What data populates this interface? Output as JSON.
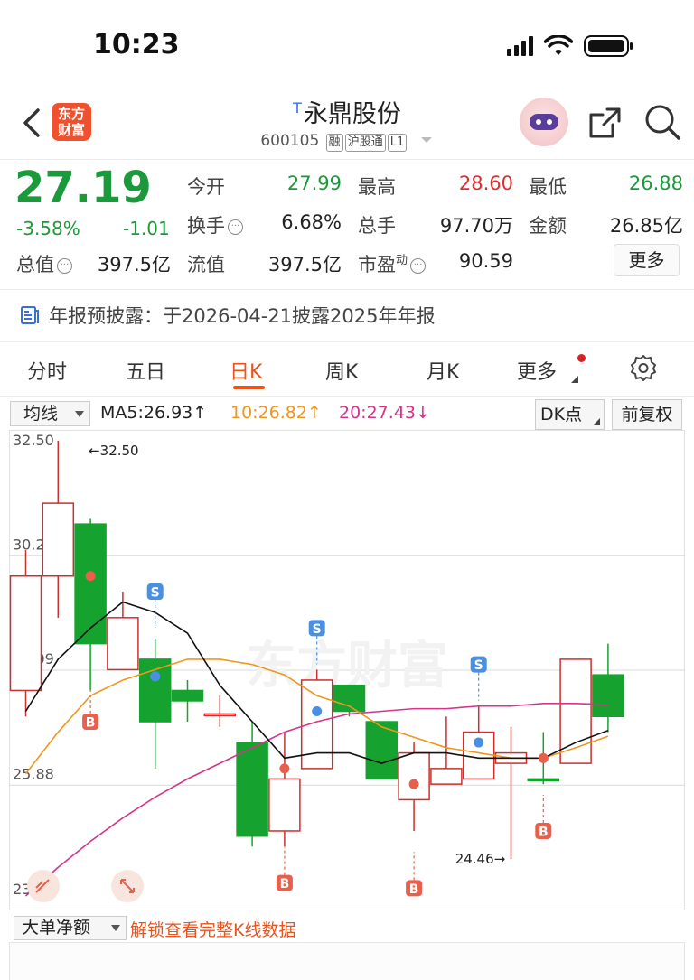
{
  "status_bar": {
    "time": "10:23"
  },
  "header": {
    "logo_text": "东方财富",
    "t_mark": "T",
    "stock_name": "永鼎股份",
    "code": "600105",
    "tags": [
      "融",
      "沪股通",
      "L1"
    ]
  },
  "quote": {
    "price": "27.19",
    "change_pct": "-3.58%",
    "change": "-1.01",
    "rows": [
      [
        {
          "label": "今开",
          "value": "27.99",
          "color": "green"
        },
        {
          "label": "最高",
          "value": "28.60",
          "color": "red"
        },
        {
          "label": "最低",
          "value": "26.88",
          "color": "green"
        }
      ],
      [
        {
          "label": "换手",
          "value": "6.68%",
          "info": true
        },
        {
          "label": "总手",
          "value": "97.70万"
        },
        {
          "label": "金额",
          "value": "26.85亿"
        }
      ]
    ],
    "row3": [
      {
        "label": "总值",
        "value": "397.5亿",
        "info": true
      },
      {
        "label": "流值",
        "value": "397.5亿"
      },
      {
        "label": "市盈",
        "sup": "动",
        "value": "90.59",
        "info": true
      }
    ],
    "more_label": "更多"
  },
  "notice": {
    "text": "年报预披露：于2026-04-21披露2025年年报"
  },
  "tabs": [
    "分时",
    "五日",
    "日K",
    "周K",
    "月K",
    "更多"
  ],
  "active_tab": 2,
  "ma_row": {
    "select": "均线",
    "ma5": "MA5:26.93↑",
    "ma10": "10:26.82↑",
    "ma20": "20:27.43↓",
    "dk_button": "DK点",
    "fq_button": "前复权"
  },
  "chart_data": {
    "type": "candlestick",
    "y_ticks": [
      "32.50",
      "30.29",
      "28.09",
      "25.88",
      "23.68"
    ],
    "ylim": [
      23.68,
      32.5
    ],
    "candles": [
      {
        "o": 27.7,
        "c": 29.9,
        "h": 30.4,
        "l": 27.2,
        "color": "red"
      },
      {
        "o": 29.9,
        "c": 31.3,
        "h": 32.5,
        "l": 29.1,
        "color": "red"
      },
      {
        "o": 30.9,
        "c": 28.6,
        "h": 31.0,
        "l": 27.7,
        "color": "green"
      },
      {
        "o": 28.1,
        "c": 29.1,
        "h": 29.6,
        "l": 28.1,
        "color": "red"
      },
      {
        "o": 28.3,
        "c": 27.1,
        "h": 28.7,
        "l": 26.2,
        "color": "green"
      },
      {
        "o": 27.7,
        "c": 27.5,
        "h": 27.9,
        "l": 27.1,
        "color": "green"
      },
      {
        "o": 27.25,
        "c": 27.25,
        "h": 27.6,
        "l": 27.0,
        "color": "red"
      },
      {
        "o": 26.7,
        "c": 24.9,
        "h": 27.1,
        "l": 24.7,
        "color": "green"
      },
      {
        "o": 25.0,
        "c": 26.0,
        "h": 26.9,
        "l": 24.7,
        "color": "red"
      },
      {
        "o": 26.2,
        "c": 27.9,
        "h": 28.1,
        "l": 26.2,
        "color": "red"
      },
      {
        "o": 27.8,
        "c": 27.3,
        "h": 27.8,
        "l": 27.2,
        "color": "green"
      },
      {
        "o": 27.1,
        "c": 26.0,
        "h": 27.1,
        "l": 26.0,
        "color": "green"
      },
      {
        "o": 25.6,
        "c": 26.5,
        "h": 26.7,
        "l": 25.0,
        "color": "red"
      },
      {
        "o": 25.9,
        "c": 26.2,
        "h": 27.2,
        "l": 25.9,
        "color": "red"
      },
      {
        "o": 26.0,
        "c": 26.9,
        "h": 27.4,
        "l": 26.0,
        "color": "red"
      },
      {
        "o": 26.3,
        "c": 26.5,
        "h": 27.0,
        "l": 24.46,
        "color": "red"
      },
      {
        "o": 26.0,
        "c": 26.0,
        "h": 26.9,
        "l": 25.9,
        "color": "green"
      },
      {
        "o": 26.3,
        "c": 28.3,
        "h": 28.3,
        "l": 26.3,
        "color": "red"
      },
      {
        "o": 28.0,
        "c": 27.2,
        "h": 28.6,
        "l": 26.9,
        "color": "green"
      }
    ],
    "ma5": [
      27.3,
      28.3,
      28.9,
      29.4,
      29.2,
      28.8,
      27.8,
      27.1,
      26.4,
      26.5,
      26.5,
      26.3,
      26.5,
      26.5,
      26.4,
      26.4,
      26.4,
      26.7,
      26.93
    ],
    "ma10": [
      26.1,
      26.9,
      27.6,
      27.9,
      28.1,
      28.3,
      28.3,
      28.2,
      28.0,
      27.6,
      27.4,
      27.0,
      26.8,
      26.6,
      26.5,
      26.4,
      26.4,
      26.6,
      26.82
    ],
    "ma20": [
      23.75,
      24.3,
      24.8,
      25.25,
      25.65,
      26.0,
      26.3,
      26.6,
      26.9,
      27.1,
      27.25,
      27.3,
      27.35,
      27.35,
      27.4,
      27.4,
      27.45,
      27.45,
      27.43
    ],
    "signals": [
      {
        "i": 2,
        "type": "dot",
        "y": 29.9,
        "color": "#e8604c"
      },
      {
        "i": 2,
        "type": "B",
        "y": 27.1
      },
      {
        "i": 4,
        "type": "dot",
        "y": 27.97,
        "color": "#4a90e2"
      },
      {
        "i": 4,
        "type": "S",
        "y": 29.6
      },
      {
        "i": 8,
        "type": "dot",
        "y": 26.2,
        "color": "#e8604c"
      },
      {
        "i": 8,
        "type": "B",
        "y": 24.0
      },
      {
        "i": 9,
        "type": "dot",
        "y": 27.3,
        "color": "#4a90e2"
      },
      {
        "i": 9,
        "type": "S",
        "y": 28.9
      },
      {
        "i": 12,
        "type": "dot",
        "y": 25.9,
        "color": "#e8604c"
      },
      {
        "i": 12,
        "type": "B",
        "y": 23.9
      },
      {
        "i": 14,
        "type": "dot",
        "y": 26.7,
        "color": "#4a90e2"
      },
      {
        "i": 14,
        "type": "S",
        "y": 28.2
      },
      {
        "i": 16,
        "type": "dot",
        "y": 26.4,
        "color": "#e8604c"
      },
      {
        "i": 16,
        "type": "B",
        "y": 25.0
      }
    ],
    "annotations": [
      {
        "text": "←32.50",
        "i": 2,
        "y": 32.5
      },
      {
        "text": "24.46→",
        "i": 14,
        "y": 24.46
      }
    ],
    "watermark": "东方财富"
  },
  "bottom": {
    "select": "大单净额",
    "unlock_text": "解锁查看完整K线数据"
  }
}
